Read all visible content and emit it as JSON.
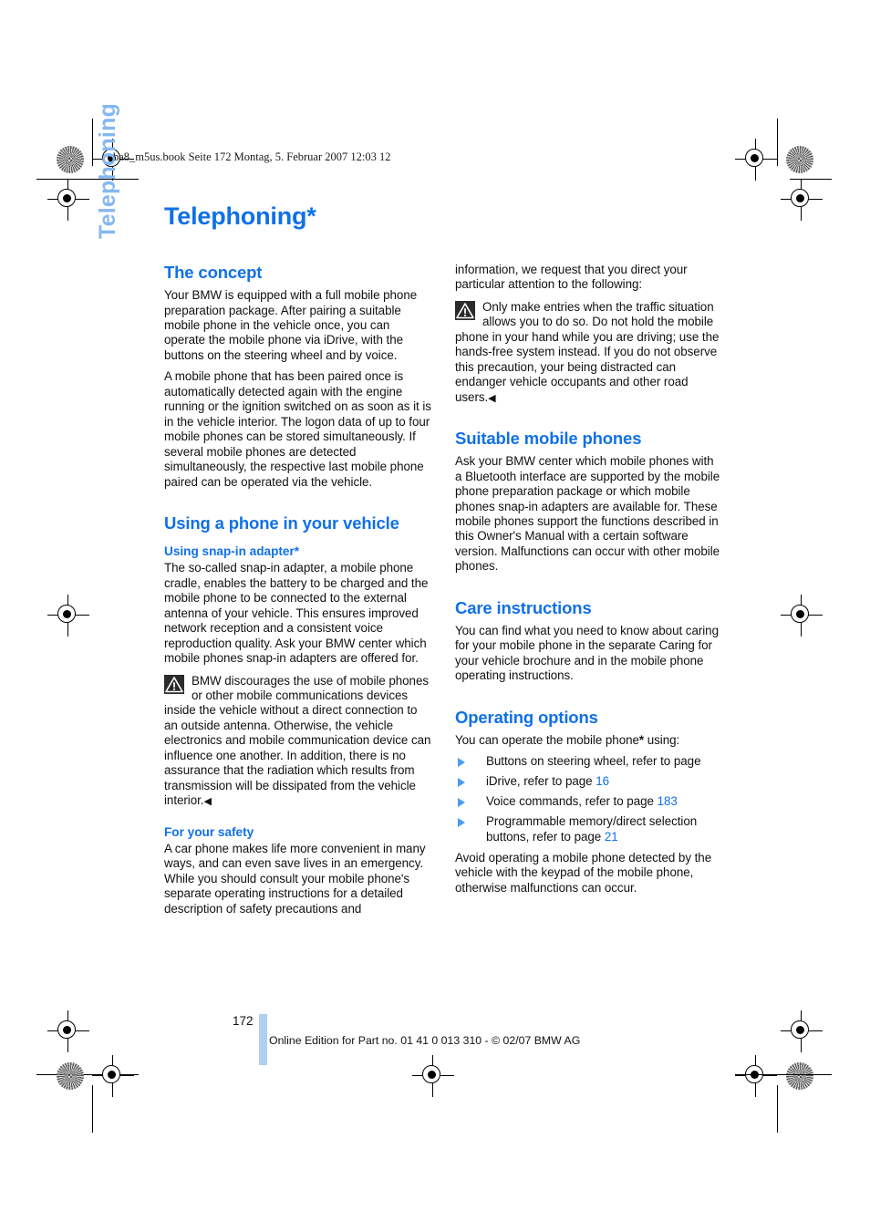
{
  "document": {
    "header_line": "ba8_m5us.book  Seite 172  Montag, 5. Februar 2007  12:03 12",
    "side_tab_label": "Telephoning",
    "chapter_title": "Telephoning*",
    "page_number": "172",
    "footer_note": "Online Edition for Part no. 01 41 0 013 310 - © 02/07 BMW AG",
    "accent_color": "#1070e8",
    "side_tab_color": "#85b8f0",
    "folio_bar_color": "#aed0f2"
  },
  "left_column": {
    "concept": {
      "heading": "The concept",
      "para1": "Your BMW is equipped with a full mobile phone preparation package. After pairing a suitable mobile phone in the vehicle once, you can operate the mobile phone via iDrive, with the buttons on the steering wheel and by voice.",
      "para2": "A mobile phone that has been paired once is automatically detected again with the engine running or the ignition switched on as soon as it is in the vehicle interior. The logon data of up to four mobile phones can be stored simultaneously. If several mobile phones are detected simultaneously, the respective last mobile phone paired can be operated via the vehicle."
    },
    "using_phone": {
      "heading": "Using a phone in your vehicle",
      "subheading_adapter": "Using snap-in adapter*",
      "adapter_para": "The so-called snap-in adapter, a mobile phone cradle, enables the battery to be charged and the mobile phone to be connected to the external antenna of your vehicle. This ensures improved network reception and a consistent voice reproduction quality. Ask your BMW center which mobile phones snap-in adapters are offered for.",
      "warning_icon": "warning-triangle-icon",
      "warning_text": "BMW discourages the use of mobile phones or other mobile communications devices inside the vehicle without a direct connection to an outside antenna. Otherwise, the vehicle electronics and mobile communication device can influence one another. In addition, there is no assurance that the radiation which results from transmission will be dissipated from the vehicle interior.",
      "warning_end_mark": "◀",
      "subheading_safety": "For your safety",
      "safety_para": "A car phone makes life more convenient in many ways, and can even save lives in an emergency. While you should consult your mobile phone's separate operating instructions for a detailed description of safety precautions and"
    }
  },
  "right_column": {
    "continued_para": "information, we request that you direct your particular attention to the following:",
    "warning": {
      "icon": "warning-triangle-icon",
      "text": "Only make entries when the traffic situation allows you to do so. Do not hold the mobile phone in your hand while you are driving; use the hands-free system instead. If you do not observe this precaution, your being distracted can endanger vehicle occupants and other road users.",
      "end_mark": "◀"
    },
    "suitable_phones": {
      "heading": "Suitable mobile phones",
      "para": "Ask your BMW center which mobile phones with a Bluetooth interface are supported by the mobile phone preparation package or which mobile phones snap-in adapters are available for. These mobile phones support the functions described in this Owner's Manual with a certain software version. Malfunctions can occur with other mobile phones."
    },
    "care_instructions": {
      "heading": "Care instructions",
      "para": "You can find what you need to know about caring for your mobile phone in the separate Caring for your vehicle brochure and in the mobile phone operating instructions."
    },
    "operating_options": {
      "heading": "Operating options",
      "intro_before_star": "You can operate the mobile phone",
      "intro_star": "*",
      "intro_after_star": " using:",
      "items": [
        {
          "text": "Buttons on steering wheel, refer to page",
          "page": ""
        },
        {
          "text": "iDrive, refer to page ",
          "page": "16"
        },
        {
          "text": "Voice commands, refer to page ",
          "page": "183"
        },
        {
          "text": "Programmable memory/direct selection buttons, refer to page ",
          "page": "21"
        }
      ],
      "closing_para": "Avoid operating a mobile phone detected by the vehicle with the keypad of the mobile phone, otherwise malfunctions can occur."
    }
  }
}
